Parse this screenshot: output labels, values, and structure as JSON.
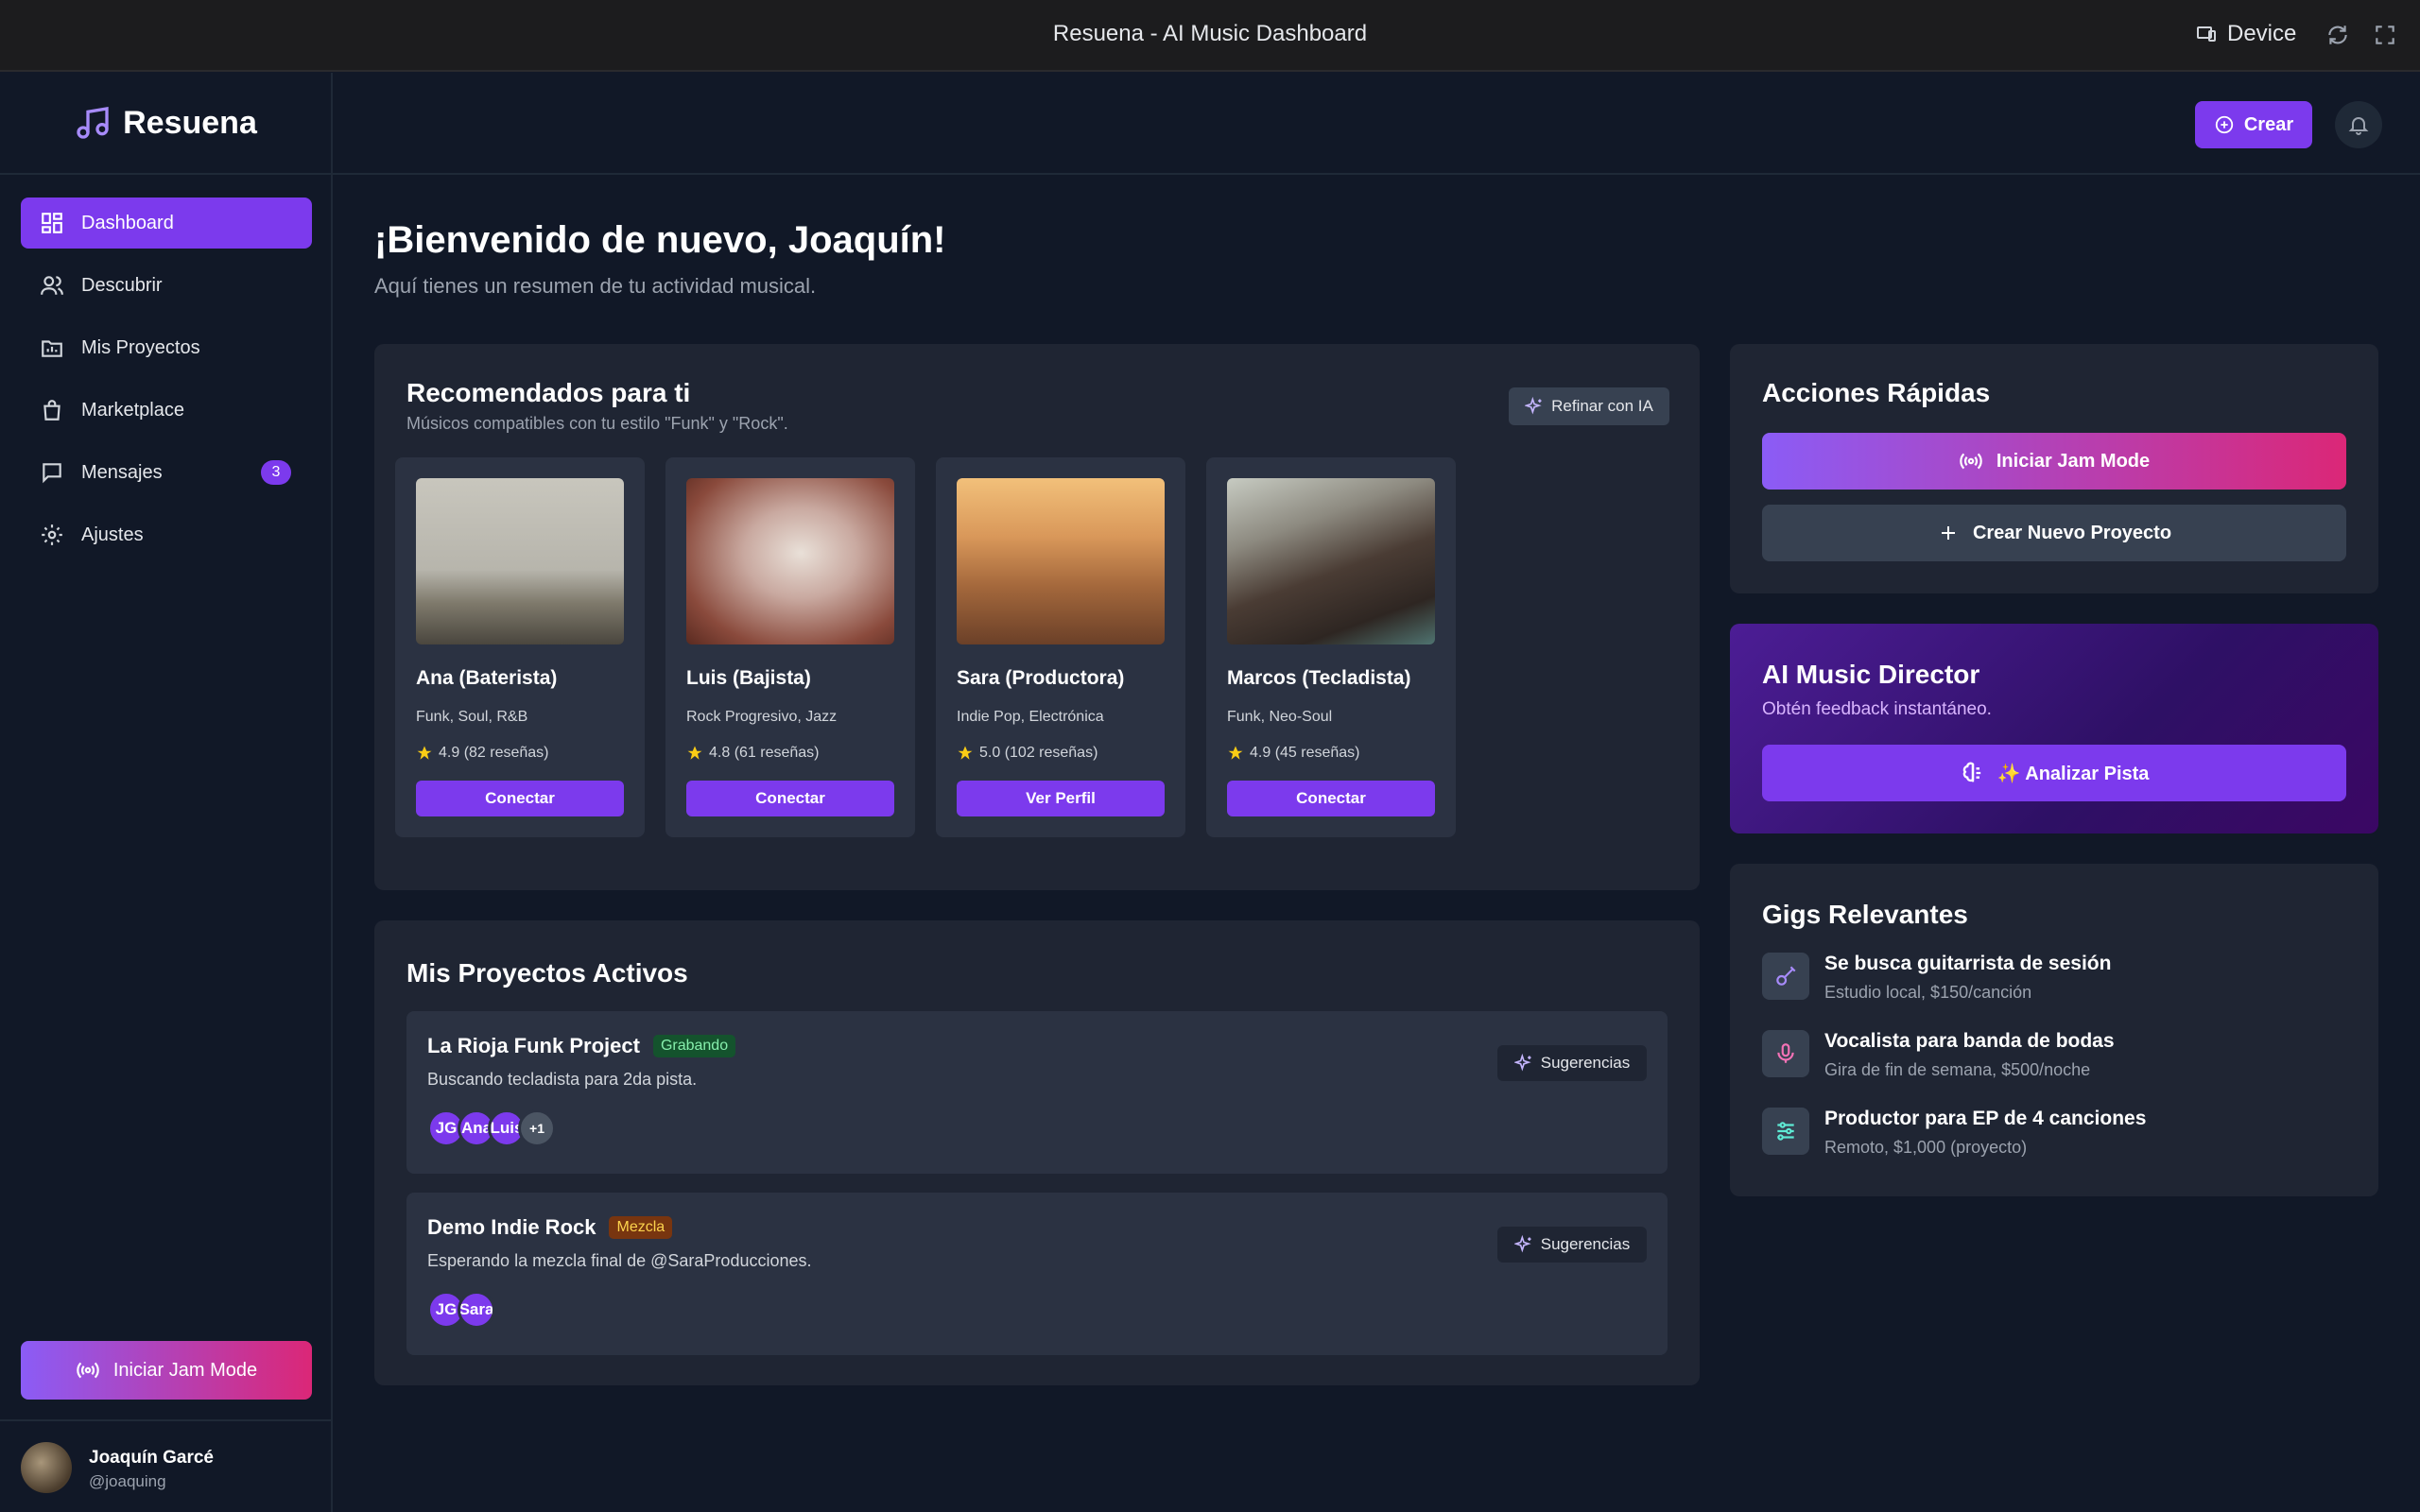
{
  "window": {
    "title": "Resuena - AI Music Dashboard",
    "device_label": "Device"
  },
  "brand": {
    "name": "Resuena"
  },
  "sidebar": {
    "items": [
      {
        "label": "Dashboard",
        "icon": "dashboard-icon",
        "active": true
      },
      {
        "label": "Descubrir",
        "icon": "users-icon"
      },
      {
        "label": "Mis Proyectos",
        "icon": "folder-icon"
      },
      {
        "label": "Marketplace",
        "icon": "shopping-bag-icon"
      },
      {
        "label": "Mensajes",
        "icon": "message-icon",
        "badge": "3"
      },
      {
        "label": "Ajustes",
        "icon": "gear-icon"
      }
    ],
    "jam_button": "Iniciar Jam Mode",
    "user": {
      "name": "Joaquín Garcé",
      "handle": "@joaquing"
    }
  },
  "header": {
    "create_label": "Crear"
  },
  "welcome": {
    "title": "¡Bienvenido de nuevo, Joaquín!",
    "subtitle": "Aquí tienes un resumen de tu actividad musical."
  },
  "recommended": {
    "title": "Recomendados para ti",
    "subtitle": "Músicos compatibles con tu estilo \"Funk\" y \"Rock\".",
    "refine_label": "Refinar con IA",
    "musicians": [
      {
        "name": "Ana (Baterista)",
        "genres": "Funk, Soul, R&B",
        "rating": "4.9 (82 reseñas)",
        "action": "Conectar"
      },
      {
        "name": "Luis (Bajista)",
        "genres": "Rock Progresivo, Jazz",
        "rating": "4.8 (61 reseñas)",
        "action": "Conectar"
      },
      {
        "name": "Sara (Productora)",
        "genres": "Indie Pop, Electrónica",
        "rating": "5.0 (102 reseñas)",
        "action": "Ver Perfil"
      },
      {
        "name": "Marcos (Tecladista)",
        "genres": "Funk, Neo-Soul",
        "rating": "4.9 (45 reseñas)",
        "action": "Conectar"
      }
    ]
  },
  "projects": {
    "title": "Mis Proyectos Activos",
    "suggest_label": "Sugerencias",
    "items": [
      {
        "name": "La Rioja Funk Project",
        "status": "Grabando",
        "description": "Buscando tecladista para 2da pista.",
        "members": [
          "JG",
          "Ana",
          "Luis"
        ],
        "extra": "+1"
      },
      {
        "name": "Demo Indie Rock",
        "status": "Mezcla",
        "description": "Esperando la mezcla final de @SaraProducciones.",
        "members": [
          "JG",
          "Sara"
        ]
      }
    ]
  },
  "quick_actions": {
    "title": "Acciones Rápidas",
    "jam_label": "Iniciar Jam Mode",
    "new_project_label": "Crear Nuevo Proyecto"
  },
  "ai_director": {
    "title": "AI Music Director",
    "subtitle": "Obtén feedback instantáneo.",
    "button_label": "✨ Analizar Pista"
  },
  "gigs": {
    "title": "Gigs Relevantes",
    "items": [
      {
        "title": "Se busca guitarrista de sesión",
        "detail": "Estudio local, $150/canción",
        "icon": "guitar-icon"
      },
      {
        "title": "Vocalista para banda de bodas",
        "detail": "Gira de fin de semana, $500/noche",
        "icon": "microphone-icon"
      },
      {
        "title": "Productor para EP de 4 canciones",
        "detail": "Remoto, $1,000 (proyecto)",
        "icon": "sliders-icon"
      }
    ]
  },
  "colors": {
    "accent": "#7c3aed",
    "background": "#111827",
    "card": "#1f2533",
    "gradient_end": "#db2777"
  }
}
